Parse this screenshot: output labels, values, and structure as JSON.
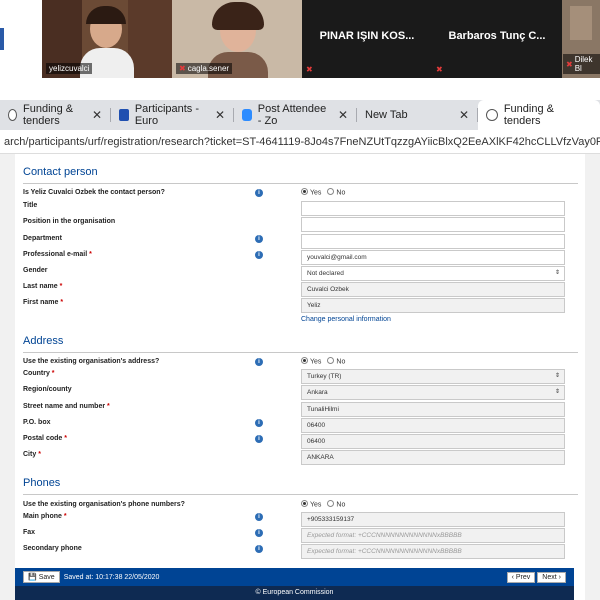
{
  "video": {
    "tiles": [
      {
        "name": "yelizcuvalci"
      },
      {
        "name": "cagla.sener"
      },
      {
        "name": "PINAR IŞIN KOS..."
      },
      {
        "name": "Barbaros Tunç C..."
      },
      {
        "name": "Dilek Bl"
      }
    ]
  },
  "browser": {
    "tabs": [
      {
        "label": "Funding & tenders"
      },
      {
        "label": "Participants - Euro"
      },
      {
        "label": "Post Attendee - Zo"
      },
      {
        "label": "New Tab"
      },
      {
        "label": "Funding & tenders"
      }
    ],
    "url": "arch/participants/urf/registration/research?ticket=ST-4641119-8Jo4s7FneNZUtTqzzgAYiicBlxQ2EeAXlKF42hcCLLVfzVay0RxhV"
  },
  "contact": {
    "title": "Contact person",
    "q_contact": "Is Yeliz Cuvalci Ozbek the contact person?",
    "yes": "Yes",
    "no": "No",
    "title_label": "Title",
    "position_label": "Position in the organisation",
    "department_label": "Department",
    "email_label": "Professional e-mail",
    "email_value": "youvalci@gmail.com",
    "gender_label": "Gender",
    "gender_value": "Not declared",
    "lastname_label": "Last name",
    "lastname_value": "Cuvalci Ozbek",
    "firstname_label": "First name",
    "firstname_value": "Yeliz",
    "change_link": "Change personal information",
    "req": "*",
    "info": "i"
  },
  "address": {
    "title": "Address",
    "q_existing": "Use the existing organisation's address?",
    "yes": "Yes",
    "no": "No",
    "country_label": "Country",
    "country_value": "Turkey (TR)",
    "region_label": "Region/county",
    "region_value": "Ankara",
    "street_label": "Street name and number",
    "street_value": "TunaliHilmi",
    "pobox_label": "P.O. box",
    "pobox_value": "06400",
    "postal_label": "Postal code",
    "postal_value": "06400",
    "city_label": "City",
    "city_value": "ANKARA"
  },
  "phones": {
    "title": "Phones",
    "q_existing": "Use the existing organisation's phone numbers?",
    "yes": "Yes",
    "no": "No",
    "main_label": "Main phone",
    "main_value": "+905333159137",
    "fax_label": "Fax",
    "fax_placeholder": "Expected format: +CCCNNNNNNNNNNNNNxBBBBB",
    "secondary_label": "Secondary phone",
    "secondary_placeholder": "Expected format: +CCCNNNNNNNNNNNNNxBBBBB"
  },
  "actions": {
    "save_label": "Save",
    "saved_text": "Saved at: 10:17:38 22/05/2020",
    "prev_label": "Prev",
    "next_label": "Next",
    "footer": "© European Commission"
  }
}
